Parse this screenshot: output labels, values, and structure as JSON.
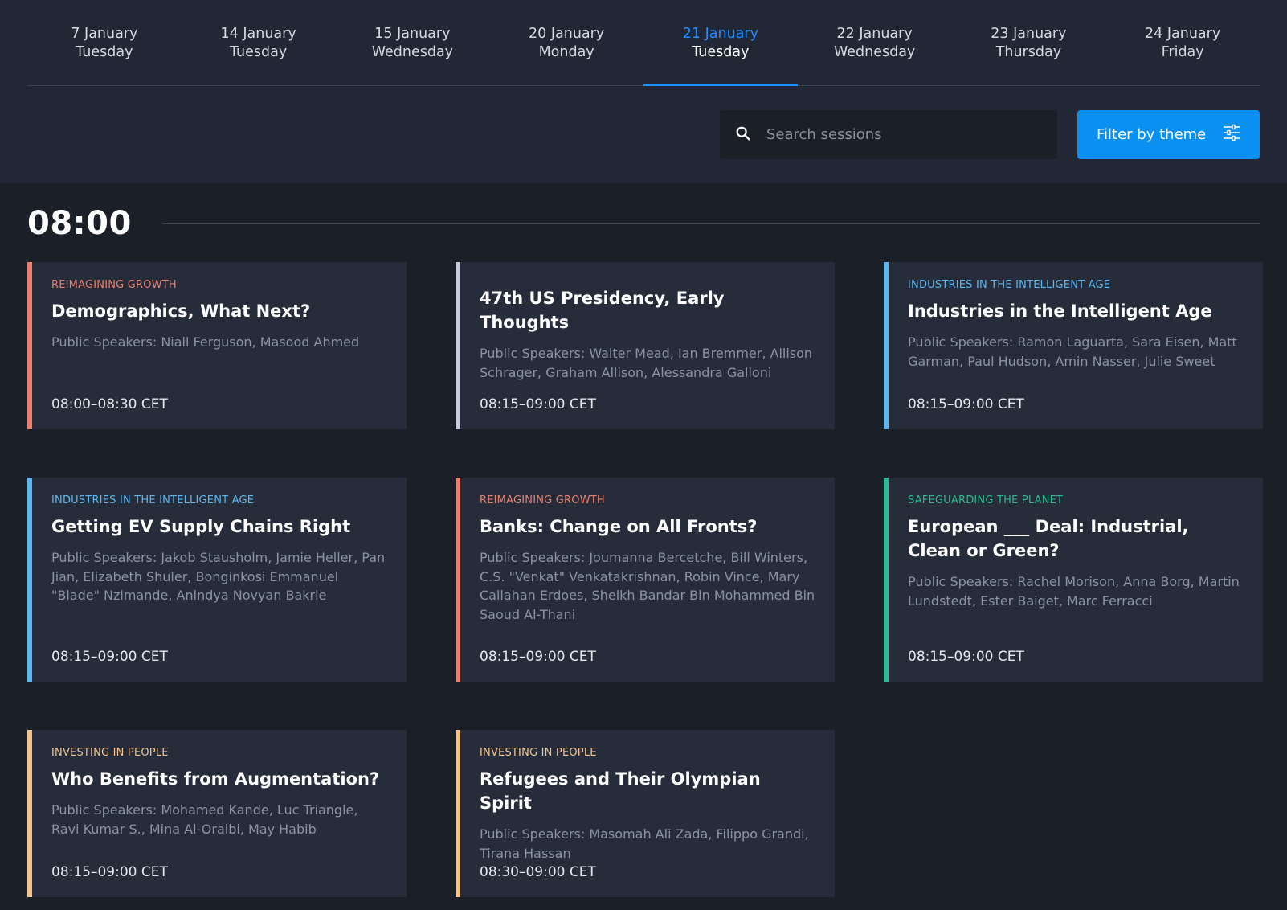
{
  "date_tabs": [
    {
      "date": "7 January",
      "weekday": "Tuesday",
      "active": false
    },
    {
      "date": "14 January",
      "weekday": "Tuesday",
      "active": false
    },
    {
      "date": "15 January",
      "weekday": "Wednesday",
      "active": false
    },
    {
      "date": "20 January",
      "weekday": "Monday",
      "active": false
    },
    {
      "date": "21 January",
      "weekday": "Tuesday",
      "active": true
    },
    {
      "date": "22 January",
      "weekday": "Wednesday",
      "active": false
    },
    {
      "date": "23 January",
      "weekday": "Thursday",
      "active": false
    },
    {
      "date": "24 January",
      "weekday": "Friday",
      "active": false
    }
  ],
  "search": {
    "placeholder": "Search sessions",
    "value": ""
  },
  "filter": {
    "label": "Filter by theme"
  },
  "time_slot": "08:00",
  "colors": {
    "accent": "#0a90f0",
    "reimagining_growth": "#e8806f",
    "industries": "#5cb7f0",
    "planet": "#2cb98f",
    "people": "#f2c38c",
    "neutral": "#c7cde0"
  },
  "sessions": [
    {
      "theme": "REIMAGINING GROWTH",
      "title": "Demographics, What Next?",
      "speakers": "Public Speakers: Niall Ferguson, Masood Ahmed",
      "time": "08:00–08:30 CET"
    },
    {
      "theme": "",
      "title": "47th US Presidency, Early Thoughts",
      "speakers": "Public Speakers: Walter Mead, Ian Bremmer, Allison Schrager, Graham Allison, Alessandra Galloni",
      "time": "08:15–09:00 CET"
    },
    {
      "theme": "INDUSTRIES IN THE INTELLIGENT AGE",
      "title": "Industries in the Intelligent Age",
      "speakers": "Public Speakers: Ramon Laguarta, Sara Eisen, Matt Garman, Paul Hudson, Amin Nasser, Julie Sweet",
      "time": "08:15–09:00 CET"
    },
    {
      "theme": "INDUSTRIES IN THE INTELLIGENT AGE",
      "title": "Getting EV Supply Chains Right",
      "speakers": "Public Speakers: Jakob Stausholm, Jamie Heller, Pan Jian, Elizabeth Shuler, Bonginkosi Emmanuel \"Blade\" Nzimande, Anindya Novyan Bakrie",
      "time": "08:15–09:00 CET"
    },
    {
      "theme": "REIMAGINING GROWTH",
      "title": "Banks: Change on All Fronts?",
      "speakers": "Public Speakers: Joumanna Bercetche, Bill Winters, C.S. \"Venkat\" Venkatakrishnan, Robin Vince, Mary Callahan Erdoes, Sheikh Bandar Bin Mohammed Bin Saoud Al-Thani",
      "time": "08:15–09:00 CET"
    },
    {
      "theme": "SAFEGUARDING THE PLANET",
      "title": "European ___ Deal: Industrial, Clean or Green?",
      "speakers": "Public Speakers: Rachel Morison, Anna Borg, Martin Lundstedt, Ester Baiget, Marc Ferracci",
      "time": "08:15–09:00 CET"
    },
    {
      "theme": "INVESTING IN PEOPLE",
      "title": "Who Benefits from Augmentation?",
      "speakers": "Public Speakers: Mohamed Kande, Luc Triangle, Ravi Kumar S., Mina Al-Oraibi, May Habib",
      "time": "08:15–09:00 CET"
    },
    {
      "theme": "INVESTING IN PEOPLE",
      "title": "Refugees and Their Olympian Spirit",
      "speakers": "Public Speakers: Masomah Ali Zada, Filippo Grandi, Tirana Hassan",
      "time": "08:30–09:00 CET"
    }
  ]
}
